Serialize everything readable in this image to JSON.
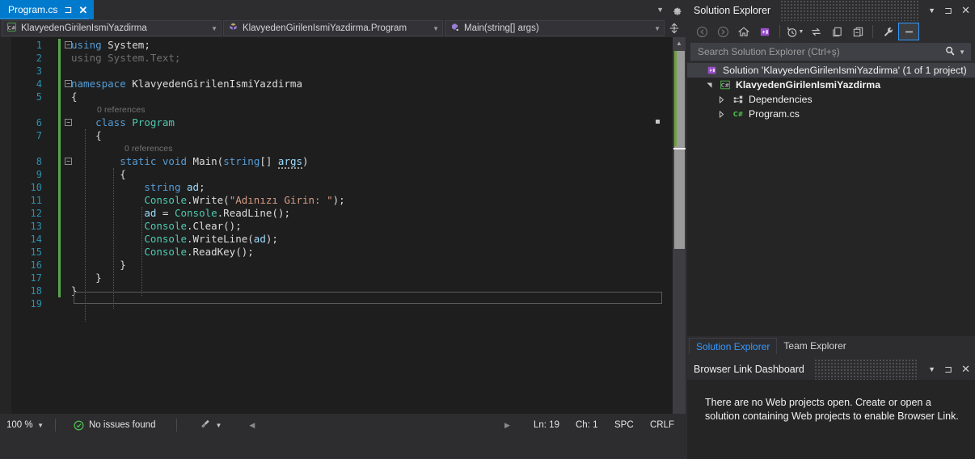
{
  "window": {
    "app": "Visual Studio",
    "accent": "#007acc",
    "bg": "#1e1e1e"
  },
  "editor": {
    "tab": {
      "title": "Program.cs",
      "pin_icon": "pin-icon",
      "close_icon": "close-icon"
    },
    "tabstrip_overflow_icon": "chevron-down-icon",
    "settings_icon": "gear-icon",
    "navbar": {
      "project": "KlavyedenGirilenIsmiYazdirma",
      "project_icon": "csharp-project-icon",
      "type": "KlavyedenGirilenIsmiYazdirma.Program",
      "type_icon": "class-icon",
      "member": "Main(string[] args)",
      "member_icon": "method-private-icon",
      "dropdown_icon": "chevron-down-icon",
      "split_icon": "split-window-icon"
    },
    "codelens": {
      "class_refs": "0 references",
      "method_refs": "0 references"
    },
    "lines": [
      {
        "n": "1",
        "fold": "minus",
        "change": true,
        "html": "<span class=\"k\">using</span> <span class=\"p\">System;</span>"
      },
      {
        "n": "2",
        "fold": "",
        "change": true,
        "html": "<span class=\"dim\">using System.Text;</span>"
      },
      {
        "n": "3",
        "fold": "",
        "change": true,
        "html": ""
      },
      {
        "n": "4",
        "fold": "minus",
        "change": true,
        "html": "<span class=\"k\">namespace</span> <span class=\"p\">KlavyedenGirilenIsmiYazdirma</span>"
      },
      {
        "n": "5",
        "fold": "",
        "change": true,
        "html": "<span class=\"p\">{</span>"
      },
      {
        "n": "6",
        "fold": "minus",
        "change": true,
        "html": "    <span class=\"k\">class</span> <span class=\"ty\">Program</span>"
      },
      {
        "n": "7",
        "fold": "",
        "change": true,
        "html": "    <span class=\"p\">{</span>"
      },
      {
        "n": "8",
        "fold": "minus",
        "change": true,
        "html": "        <span class=\"k\">static</span> <span class=\"k\">void</span> <span class=\"p\">Main(</span><span class=\"k\">string</span><span class=\"p\">[] </span><span class=\"id sq\">args</span><span class=\"p\">)</span>"
      },
      {
        "n": "9",
        "fold": "",
        "change": true,
        "html": "        <span class=\"p\">{</span>"
      },
      {
        "n": "10",
        "fold": "",
        "change": true,
        "html": "            <span class=\"k\">string</span> <span class=\"id\">ad</span><span class=\"p\">;</span>"
      },
      {
        "n": "11",
        "fold": "",
        "change": true,
        "html": "            <span class=\"ty\">Console</span><span class=\"p\">.Write(</span><span class=\"st\">\"Adınızı Girin: \"</span><span class=\"p\">);</span>"
      },
      {
        "n": "12",
        "fold": "",
        "change": true,
        "html": "            <span class=\"id\">ad</span> <span class=\"p\">= </span><span class=\"ty\">Console</span><span class=\"p\">.ReadLine();</span>"
      },
      {
        "n": "13",
        "fold": "",
        "change": true,
        "html": "            <span class=\"ty\">Console</span><span class=\"p\">.Clear();</span>"
      },
      {
        "n": "14",
        "fold": "",
        "change": true,
        "html": "            <span class=\"ty\">Console</span><span class=\"p\">.WriteLine(</span><span class=\"id\">ad</span><span class=\"p\">);</span>"
      },
      {
        "n": "15",
        "fold": "",
        "change": true,
        "html": "            <span class=\"ty\">Console</span><span class=\"p\">.ReadKey();</span>"
      },
      {
        "n": "16",
        "fold": "",
        "change": true,
        "html": "        <span class=\"p\">}</span>"
      },
      {
        "n": "17",
        "fold": "",
        "change": true,
        "html": "    <span class=\"p\">}</span>"
      },
      {
        "n": "18",
        "fold": "",
        "change": true,
        "html": "<span class=\"p\">}</span>"
      },
      {
        "n": "19",
        "fold": "",
        "change": false,
        "html": ""
      }
    ],
    "code_text": [
      "using System;",
      "using System.Text;",
      "",
      "namespace KlavyedenGirilenIsmiYazdirma",
      "{",
      "    class Program",
      "    {",
      "        static void Main(string[] args)",
      "        {",
      "            string ad;",
      "            Console.Write(\"Adınızı Girin: \");",
      "            ad = Console.ReadLine();",
      "            Console.Clear();",
      "            Console.WriteLine(ad);",
      "            Console.ReadKey();",
      "        }",
      "    }",
      "}",
      ""
    ],
    "scrollbar": {
      "up_icon": "scroll-up-icon",
      "down_icon": "scroll-down-icon"
    }
  },
  "statusbar": {
    "zoom": "100 %",
    "zoom_arrow_icon": "chevron-down-icon",
    "issues_icon": "check-circle-icon",
    "issues": "No issues found",
    "brush_icon": "brush-icon",
    "brush_arrow_icon": "chevron-down-icon",
    "nav_back_icon": "triangle-left-icon",
    "nav_fwd_icon": "triangle-right-icon",
    "line": "Ln: 19",
    "column": "Ch: 1",
    "spaces": "SPC",
    "lineending": "CRLF"
  },
  "solution_explorer": {
    "title": "Solution Explorer",
    "header_icons": {
      "dropdown": "chevron-down-icon",
      "pin": "pin-icon",
      "close": "close-icon"
    },
    "toolbar": [
      {
        "name": "back-icon",
        "glyph": "back",
        "state": "disabled"
      },
      {
        "name": "forward-icon",
        "glyph": "forward",
        "state": "disabled"
      },
      {
        "name": "home-icon",
        "glyph": "home",
        "state": "normal"
      },
      {
        "name": "solution-icon",
        "glyph": "solution",
        "state": "normal"
      },
      {
        "name": "pending-changes-icon",
        "glyph": "clock",
        "state": "normal",
        "has_caret": true
      },
      {
        "name": "sync-icon",
        "glyph": "sync",
        "state": "normal"
      },
      {
        "name": "show-all-files-icon",
        "glyph": "allfiles",
        "state": "normal"
      },
      {
        "name": "collapse-all-icon",
        "glyph": "collapse",
        "state": "normal"
      },
      {
        "name": "properties-icon",
        "glyph": "wrench",
        "state": "normal"
      },
      {
        "name": "preview-selected-items-icon",
        "glyph": "preview",
        "state": "selected"
      }
    ],
    "search": {
      "placeholder": "Search Solution Explorer (Ctrl+ş)",
      "value": "",
      "search_icon": "search-icon",
      "options_icon": "chevron-down-icon"
    },
    "tree": [
      {
        "indent": 0,
        "twisty": "",
        "icon": "solution-icon",
        "label": "Solution 'KlavyedenGirilenIsmiYazdirma' (1 of 1 project)",
        "bold": false,
        "selected": true
      },
      {
        "indent": 1,
        "twisty": "expanded",
        "icon": "csharp-project-icon",
        "label": "KlavyedenGirilenIsmiYazdirma",
        "bold": true,
        "selected": false
      },
      {
        "indent": 2,
        "twisty": "collapsed",
        "icon": "dependencies-icon",
        "label": "Dependencies",
        "bold": false,
        "selected": false
      },
      {
        "indent": 2,
        "twisty": "collapsed",
        "icon": "csharp-file-icon",
        "label": "Program.cs",
        "bold": false,
        "selected": false
      }
    ],
    "tabs": [
      {
        "label": "Solution Explorer",
        "active": true
      },
      {
        "label": "Team Explorer",
        "active": false
      }
    ]
  },
  "browser_link": {
    "title": "Browser Link Dashboard",
    "header_icons": {
      "dropdown": "chevron-down-icon",
      "pin": "pin-icon",
      "close": "close-icon"
    },
    "message": "There are no Web projects open. Create or open a solution containing Web projects to enable Browser Link."
  }
}
